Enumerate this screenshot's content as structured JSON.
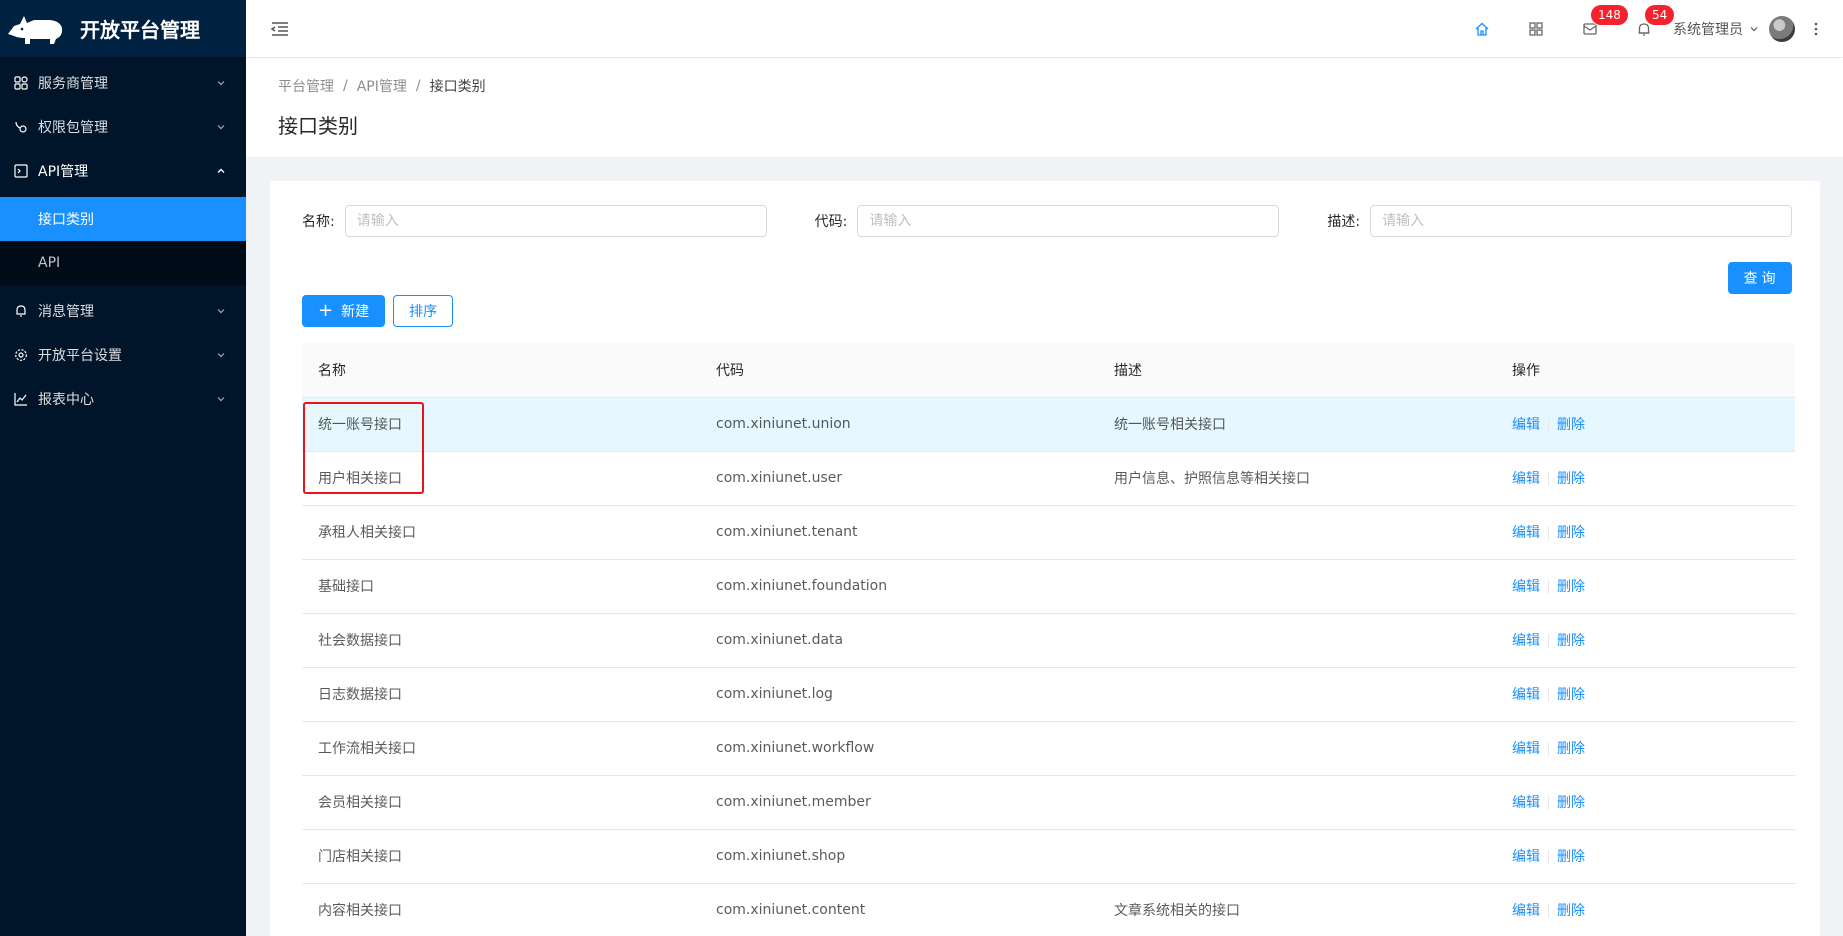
{
  "app": {
    "title": "开放平台管理"
  },
  "sidebar": {
    "items": [
      {
        "label": "服务商管理",
        "icon": "grid-icon"
      },
      {
        "label": "权限包管理",
        "icon": "hook-icon"
      },
      {
        "label": "API管理",
        "icon": "api-doc-icon",
        "open": true,
        "children": [
          {
            "label": "接口类别",
            "active": true
          },
          {
            "label": "API"
          }
        ]
      },
      {
        "label": "消息管理",
        "icon": "bell-icon"
      },
      {
        "label": "开放平台设置",
        "icon": "gear-icon"
      },
      {
        "label": "报表中心",
        "icon": "line-chart-icon"
      }
    ]
  },
  "header": {
    "mail_badge": "148",
    "bell_badge": "54",
    "user_name": "系统管理员"
  },
  "breadcrumb": [
    "平台管理",
    "API管理",
    "接口类别"
  ],
  "page": {
    "title": "接口类别"
  },
  "filters": {
    "name_label": "名称:",
    "code_label": "代码:",
    "desc_label": "描述:",
    "placeholder": "请输入"
  },
  "buttons": {
    "query": "查询",
    "new": "新建",
    "sort": "排序"
  },
  "table": {
    "columns": [
      "名称",
      "代码",
      "描述",
      "操作"
    ],
    "edit_label": "编辑",
    "delete_label": "删除",
    "rows": [
      {
        "name": "统一账号接口",
        "code": "com.xiniunet.union",
        "desc": "统一账号相关接口"
      },
      {
        "name": "用户相关接口",
        "code": "com.xiniunet.user",
        "desc": "用户信息、护照信息等相关接口"
      },
      {
        "name": "承租人相关接口",
        "code": "com.xiniunet.tenant",
        "desc": ""
      },
      {
        "name": "基础接口",
        "code": "com.xiniunet.foundation",
        "desc": ""
      },
      {
        "name": "社会数据接口",
        "code": "com.xiniunet.data",
        "desc": ""
      },
      {
        "name": "日志数据接口",
        "code": "com.xiniunet.log",
        "desc": ""
      },
      {
        "name": "工作流相关接口",
        "code": "com.xiniunet.workflow",
        "desc": ""
      },
      {
        "name": "会员相关接口",
        "code": "com.xiniunet.member",
        "desc": ""
      },
      {
        "name": "门店相关接口",
        "code": "com.xiniunet.shop",
        "desc": ""
      },
      {
        "name": "内容相关接口",
        "code": "com.xiniunet.content",
        "desc": "文章系统相关的接口"
      }
    ]
  },
  "colors": {
    "primary": "#1890ff",
    "sidebar_bg": "#001529",
    "highlight_box": "#e8141b",
    "hover_row": "#e6f7ff"
  }
}
